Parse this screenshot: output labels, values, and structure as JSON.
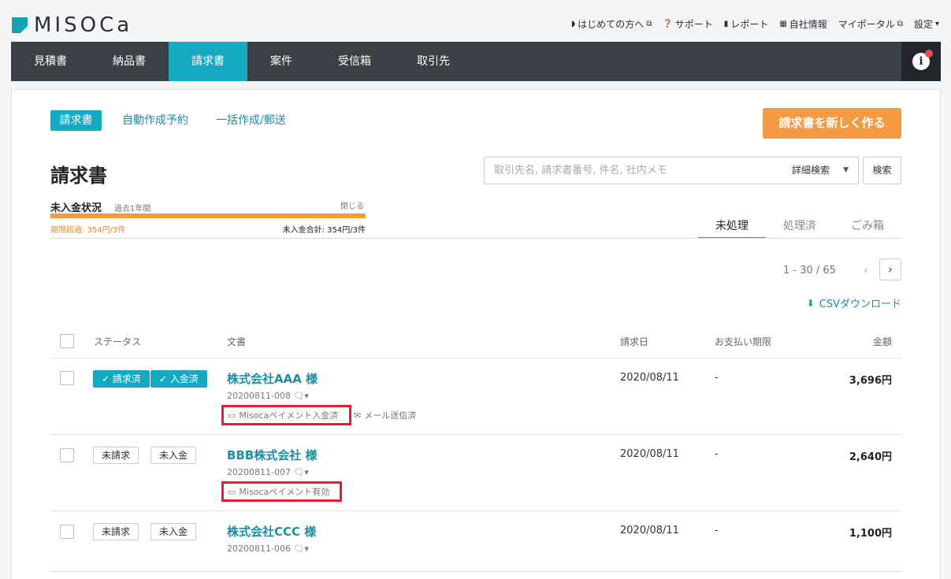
{
  "brand": {
    "name": "MISOCa"
  },
  "top_nav": [
    {
      "icon": "beginner-mark-icon",
      "label": "はじめての方へ",
      "external": "⧉"
    },
    {
      "icon": "help-icon",
      "label": "サポート"
    },
    {
      "icon": "report-icon",
      "label": "レポート"
    },
    {
      "icon": "company-icon",
      "label": "自社情報"
    },
    {
      "label": "マイポータル",
      "external": "⧉"
    },
    {
      "label": "設定",
      "caret": "▾"
    }
  ],
  "main_nav": {
    "items": [
      "見積書",
      "納品書",
      "請求書",
      "案件",
      "受信箱",
      "取引先"
    ],
    "active_index": 2,
    "info_label": "i"
  },
  "sub_tabs": {
    "invoice": "請求書",
    "auto": "自動作成予約",
    "bulk": "一括作成/郵送"
  },
  "new_button": "請求書を新しく作る",
  "page_title": "請求書",
  "search": {
    "placeholder": "取引先名, 請求書番号, 件名, 社内メモ",
    "value": "",
    "advanced": "詳細検索",
    "button": "検索"
  },
  "unpaid": {
    "title": "未入金状況",
    "period": "過去1年間",
    "close": "閉じる",
    "overdue": "期限超過: 354円/3件",
    "total": "未入金合計: 354円/3件",
    "overdue_fraction": 1.0
  },
  "status_tabs": {
    "open": "未処理",
    "done": "処理済",
    "trash": "ごみ箱"
  },
  "pager": {
    "text": "1 - 30 / 65",
    "prev": "‹",
    "next": "›"
  },
  "csv_label": "CSVダウンロード",
  "table": {
    "headers": {
      "status": "ステータス",
      "document": "文書",
      "date": "請求日",
      "due": "お支払い期限",
      "amount": "金額"
    },
    "rows": [
      {
        "status1": "✓ 請求済",
        "status2": "✓ 入金済",
        "done": true,
        "client": "株式会社AAA 様",
        "docno": "20200811-008",
        "memo_icon": "🗨▾",
        "payment_tag": "Misocaペイメント入金済",
        "mail_tag": "メール送信済",
        "date": "2020/08/11",
        "due": "-",
        "amount": "3,696円"
      },
      {
        "status1": "未請求",
        "status2": "未入金",
        "done": false,
        "client": "BBB株式会社 様",
        "docno": "20200811-007",
        "memo_icon": "🗨▾",
        "payment_tag": "Misocaペイメント有効",
        "date": "2020/08/11",
        "due": "-",
        "amount": "2,640円"
      },
      {
        "status1": "未請求",
        "status2": "未入金",
        "done": false,
        "client": "株式会社CCC 様",
        "docno": "20200811-006",
        "memo_icon": "🗨▾",
        "date": "2020/08/11",
        "due": "-",
        "amount": "1,100円"
      }
    ]
  },
  "colors": {
    "accent": "#15a8c1",
    "nav_bg": "#3b3f46",
    "orange": "#f39a43",
    "highlight": "#e0202e"
  }
}
